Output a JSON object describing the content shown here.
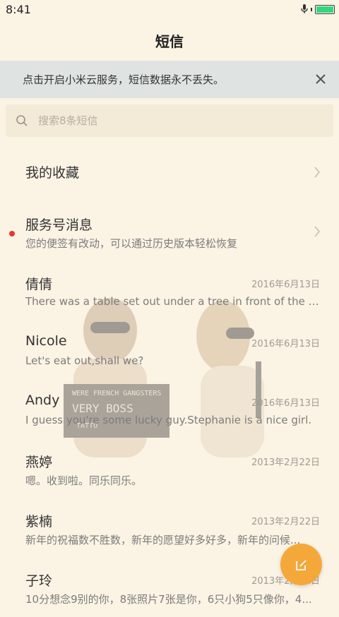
{
  "status_bar": {
    "time": "8:41",
    "battery_level": 1.0,
    "battery_color": "#37d67a",
    "icons": [
      "microphone-icon",
      "battery-icon"
    ]
  },
  "header": {
    "title": "短信"
  },
  "banner": {
    "text": "点击开启小米云服务，短信数据永不丢失。",
    "close_icon": "close-icon"
  },
  "search": {
    "placeholder": "搜索8条短信",
    "icon": "search-icon"
  },
  "list": {
    "favorites": {
      "title": "我的收藏"
    },
    "service": {
      "title": "服务号消息",
      "subtitle": "您的便签有改动，可以通过历史版本轻松恢复",
      "unread_color": "#e53935"
    },
    "conversations": [
      {
        "name": "倩倩",
        "preview": "There was a table set out under a tree in front of the ho...",
        "date": "2016年6月13日"
      },
      {
        "name": "Nicole",
        "preview": "Let's eat out,shall we?",
        "date": "2016年6月13日"
      },
      {
        "name": "Andy",
        "preview": "I guess you're some lucky guy.Stephanie is a nice girl.",
        "date": "2016年6月13日"
      },
      {
        "name": "燕婷",
        "preview": "嗯。收到啦。同乐同乐。",
        "date": "2013年2月22日"
      },
      {
        "name": "紫楠",
        "preview": "新年的祝福数不胜数，新年的愿望好多好多，新年的问候...",
        "date": "2013年2月22日"
      },
      {
        "name": "子玲",
        "preview": "10分想念9别的你，8张照片7张是你，6只小狗5只像你，4...",
        "date": "2013年2月22日"
      }
    ]
  },
  "background": {
    "sign_line1": "WERE FRENCH GANGSTERS",
    "sign_line2": "VERY BOSS",
    "sign_line3": "TATTO"
  },
  "fab": {
    "icon": "compose-icon",
    "color": "#f5a83a"
  }
}
